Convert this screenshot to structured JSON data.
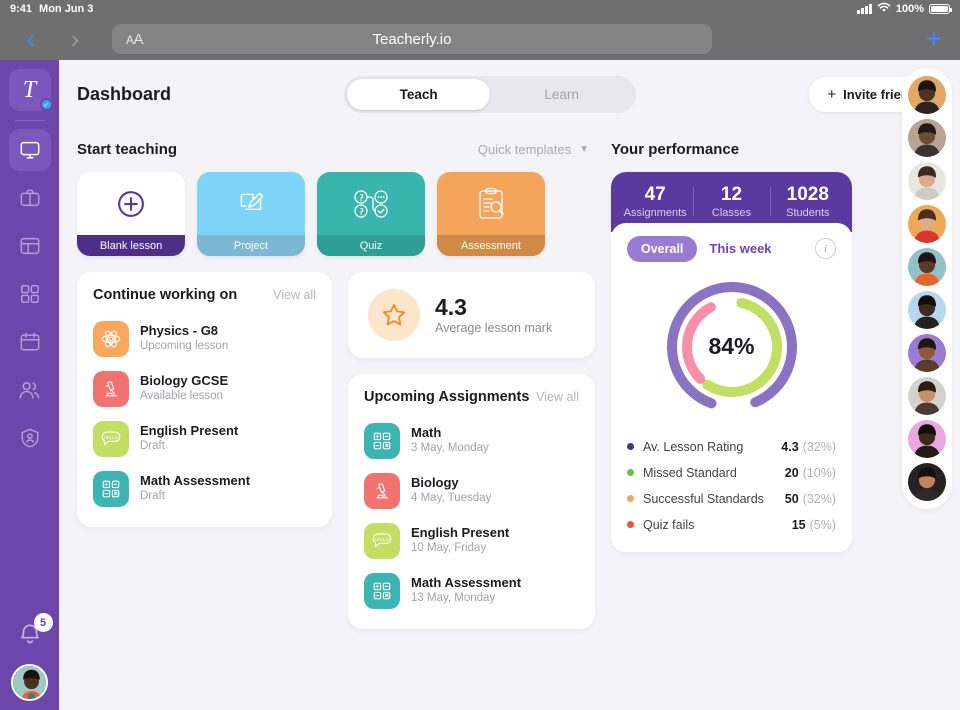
{
  "statusbar": {
    "time": "9:41",
    "date": "Mon Jun 3",
    "battery": "100%",
    "icons": [
      "signal-icon",
      "wifi-icon",
      "battery-icon"
    ]
  },
  "browser": {
    "back_icon": "chevron-left-icon",
    "forward_icon": "chevron-right-icon",
    "aa_label": "AA",
    "url": "Teacherly.io",
    "new_tab_icon": "plus-icon"
  },
  "sidebar": {
    "logo": "T",
    "items": [
      {
        "name": "dashboard",
        "icon": "monitor-icon",
        "selected": true
      },
      {
        "name": "lessons",
        "icon": "briefcase-icon",
        "selected": false
      },
      {
        "name": "library",
        "icon": "layout-icon",
        "selected": false
      },
      {
        "name": "apps",
        "icon": "grid-icon",
        "selected": false
      },
      {
        "name": "calendar",
        "icon": "calendar-icon",
        "selected": false
      },
      {
        "name": "students",
        "icon": "people-icon",
        "selected": false
      },
      {
        "name": "account",
        "icon": "shield-user-icon",
        "selected": false
      }
    ],
    "notifications": {
      "icon": "bell-icon",
      "count": "5"
    },
    "profile_icon": "avatar"
  },
  "header": {
    "title": "Dashboard",
    "toggle": {
      "options": [
        "Teach",
        "Learn"
      ],
      "active": "Teach"
    },
    "invite": {
      "label": "Invite friends",
      "icon": "plus-icon"
    }
  },
  "start_teaching": {
    "title": "Start teaching",
    "quick_templates": {
      "label": "Quick templates",
      "icon": "chevron-down-icon"
    },
    "cards": [
      {
        "label": "Blank lesson",
        "icon": "plus-circle-icon",
        "bg": "#ffffff",
        "foot": "#4c2f87",
        "foot_text": "#ffffff",
        "icon_color": "#5b3aa0"
      },
      {
        "label": "Project",
        "icon": "design-pencil-icon",
        "bg": "#7ed4f7",
        "foot": "#7cb8d4",
        "foot_text": "#ffffff",
        "icon_color": "#ffffff"
      },
      {
        "label": "Quiz",
        "icon": "quiz-nodes-icon",
        "bg": "#38b5ad",
        "foot": "#2e9e96",
        "foot_text": "#ffffff",
        "icon_color": "#ffffff"
      },
      {
        "label": "Assessment",
        "icon": "clipboard-search-icon",
        "bg": "#f5a45c",
        "foot": "#d18a46",
        "foot_text": "#ffffff",
        "icon_color": "#ffffff"
      }
    ]
  },
  "continue_working": {
    "title": "Continue working on",
    "view_all": "View all",
    "items": [
      {
        "title": "Physics - G8",
        "subtitle": "Upcoming lesson",
        "icon": "atom-icon",
        "color": "#f8a75c"
      },
      {
        "title": "Biology GCSE",
        "subtitle": "Available lesson",
        "icon": "microscope-icon",
        "color": "#f2726f"
      },
      {
        "title": "English Present",
        "subtitle": "Draft",
        "icon": "speech-hello-icon",
        "color": "#c2de63"
      },
      {
        "title": "Math Assessment",
        "subtitle": "Draft",
        "icon": "calculator-icon",
        "color": "#3cb5b2"
      }
    ]
  },
  "average_mark": {
    "value": "4.3",
    "label": "Average lesson mark",
    "icon": "star-icon",
    "circle_color": "#fde5cc",
    "icon_color": "#f28b2b"
  },
  "upcoming_assignments": {
    "title": "Upcoming Assignments",
    "view_all": "View all",
    "items": [
      {
        "title": "Math",
        "subtitle": "3 May, Monday",
        "icon": "calculator-icon",
        "color": "#3cb5b2"
      },
      {
        "title": "Biology",
        "subtitle": "4 May, Tuesday",
        "icon": "microscope-icon",
        "color": "#f2726f"
      },
      {
        "title": "English Present",
        "subtitle": "10 May, Friday",
        "icon": "speech-hello-icon",
        "color": "#c2de63"
      },
      {
        "title": "Math Assessment",
        "subtitle": "13 May, Monday",
        "icon": "calculator-icon",
        "color": "#3cb5b2"
      }
    ]
  },
  "performance": {
    "title": "Your performance",
    "stats": [
      {
        "number": "47",
        "label": "Assignments"
      },
      {
        "number": "12",
        "label": "Classes"
      },
      {
        "number": "1028",
        "label": "Students"
      }
    ],
    "tabs": {
      "options": [
        "Overall",
        "This week"
      ],
      "active": "Overall",
      "info_icon": "info-icon"
    }
  },
  "chart_data": {
    "type": "pie",
    "title": "Your performance",
    "center_label": "84%",
    "rings": [
      {
        "name": "outer",
        "segments": [
          {
            "label": "Av. Lesson Rating",
            "percent": 88,
            "color": "#8b73c4",
            "start_deg": 200
          }
        ]
      },
      {
        "name": "inner",
        "segments": [
          {
            "label": "Missed Standard",
            "percent": 56,
            "color": "#c2de63",
            "start_deg": 12
          },
          {
            "label": "Successful Standards",
            "percent": 34,
            "color": "#f88fa8",
            "start_deg": 225
          }
        ]
      }
    ],
    "legend_position": "bottom",
    "legend": [
      {
        "label": "Av. Lesson Rating",
        "value": "4.3",
        "percent": "(32%)",
        "color": "#4b2d8f"
      },
      {
        "label": "Missed Standard",
        "value": "20",
        "percent": "(10%)",
        "color": "#6cc04a"
      },
      {
        "label": "Successful Standards",
        "value": "50",
        "percent": "(32%)",
        "color": "#f8a75c"
      },
      {
        "label": "Quiz fails",
        "value": "15",
        "percent": "(5%)",
        "color": "#f2542d"
      }
    ]
  },
  "avatar_rail": {
    "avatars": [
      {
        "bg": "#e0a864",
        "skin": "#4a3428",
        "hair": "#1d1410",
        "shirt": "#2b2320"
      },
      {
        "bg": "#b9a392",
        "skin": "#6b4c35",
        "hair": "#241a14",
        "shirt": "#3b3330"
      },
      {
        "bg": "#e8e6e1",
        "skin": "#d8a98a",
        "hair": "#3a2a20",
        "shirt": "#cfcac2"
      },
      {
        "bg": "#eda85a",
        "skin": "#e0ab85",
        "hair": "#4a2f22",
        "shirt": "#d8362f"
      },
      {
        "bg": "#93c1c9",
        "skin": "#5a3b28",
        "hair": "#1f1511",
        "shirt": "#e8642c"
      },
      {
        "bg": "#b5d8ee",
        "skin": "#3f2a1d",
        "hair": "#140e0b",
        "shirt": "#23201e"
      },
      {
        "bg": "#9b7ad1",
        "skin": "#8a5a3a",
        "hair": "#201713",
        "shirt": "#5c3a2a"
      },
      {
        "bg": "#d5d2cd",
        "skin": "#c98f66",
        "hair": "#2a1d16",
        "shirt": "#4a3a33"
      },
      {
        "bg": "#eaa8e0",
        "skin": "#3d281c",
        "hair": "#130d0a",
        "shirt": "#221b16"
      },
      {
        "bg": "#262223",
        "skin": "#c0835e",
        "hair": "#14100f",
        "shirt": "#2e2a2b"
      }
    ]
  },
  "theme": {
    "accent": "#6b46ab",
    "deep_purple": "#5b3aa0",
    "bg": "#f4f3f8"
  }
}
